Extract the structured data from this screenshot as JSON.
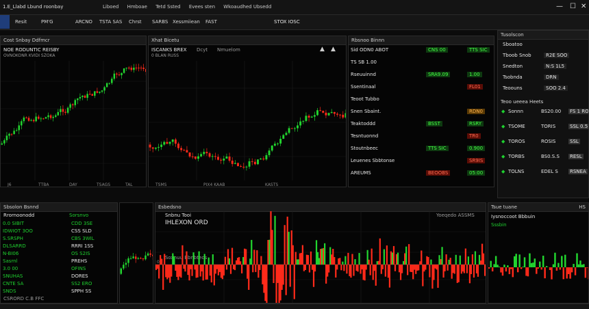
{
  "window": {
    "title": "1.E_Llabd Lbund roonbay",
    "menu": [
      "Liboed",
      "Hmboae",
      "Tetd Ssted",
      "Evees sten",
      "Wkoaudhed Ubsedd"
    ]
  },
  "toolbar": {
    "items": [
      "Resit",
      "PM'G",
      "ARCNO",
      "TSTA SAS",
      "Chrst",
      "SARBS",
      "Xessmiiean",
      "FAST"
    ],
    "center_label": "STOX IOSC"
  },
  "right_header": {
    "label": "Tusolscon"
  },
  "chart1": {
    "header": "Cost Snbay Ddfmcr",
    "title": "NOE RODUNTIC REISBY",
    "subtitle": "OVNOKONR KVIDI SZOKA",
    "x_labels": [
      "J6",
      "TTBA",
      "DAY",
      "TSAGS",
      "TAL"
    ]
  },
  "chart2": {
    "header": "Xhat Bicetu",
    "title": "ISCANKS BREX",
    "subtitle": "0 BLAN RUSS",
    "labels": [
      "Dcyt",
      "Nmuelom"
    ],
    "x_labels": [
      "TSMS",
      "PIX4 KAAB",
      "KASTS"
    ]
  },
  "watch": {
    "header": "Rbsnoo Binnn",
    "rows": [
      {
        "name": "Sid ODN0 ABOT",
        "v1": "CNS 00",
        "v2": "TTS SIC"
      },
      {
        "name": "TS SB 1.00",
        "v1": "",
        "v2": ""
      },
      {
        "name": "Rseuuinnd",
        "v1": "SRA9.09",
        "v2": "1.00"
      },
      {
        "name": "Ssentinaal",
        "v1": "",
        "v2": "FL01"
      },
      {
        "name": "Teoot Tubbo",
        "v1": "",
        "v2": ""
      },
      {
        "name": "Snen Sbaint.",
        "v1": "",
        "v2": "RDN0"
      },
      {
        "name": "Teaktoddd",
        "v1": "BSST",
        "v2": "RSRY"
      },
      {
        "name": "Tesntuonnd",
        "v1": "",
        "v2": "TR0"
      },
      {
        "name": "Stoutnbeec",
        "v1": "TTS SIC",
        "v2": "0.900"
      },
      {
        "name": "Leuenes Sbbtonse",
        "v1": "",
        "v2": "SR9IS"
      },
      {
        "name": "AREUMS",
        "v1": "BEOOBS",
        "v2": "05:00"
      }
    ]
  },
  "orders": {
    "header": "Tusolscon",
    "top": [
      {
        "label": "Sboatoo",
        "value": ""
      },
      {
        "label": "Tboob Snob",
        "value": "R2E SOO"
      },
      {
        "label": "Snedton",
        "value": "N:S 1L5"
      },
      {
        "label": "Tsobnda",
        "value": "DRN"
      },
      {
        "label": "Teoouns",
        "value": "SOO 2.4"
      }
    ],
    "subheader": "Teoo ueeea Heets",
    "rows": [
      {
        "label": "Sonnn",
        "value": "BS20.00",
        "delta": "FS 1 ROS"
      },
      {
        "label": "TSOME",
        "value": "TORIS",
        "delta": "SSL 0.5"
      },
      {
        "label": "TOROS",
        "value": "ROSIS",
        "delta": "SSL"
      },
      {
        "label": "TORBS",
        "value": "BS0.S.S",
        "delta": "RESL"
      },
      {
        "label": "TOLNS",
        "value": "EDEL S",
        "delta": "RSNEA"
      }
    ]
  },
  "bottom_left": {
    "header": "Sbsolon Bsnnd",
    "sub": "Rrornoonodd",
    "label2": "Sorsnvo",
    "rows": [
      {
        "name": "0.0 SIBIT",
        "v": "CDD 3SE"
      },
      {
        "name": "IDWIOT 3OO",
        "v": "CSS SLD"
      },
      {
        "name": "S.SRSPH",
        "v": "CBS 3WIL"
      },
      {
        "name": "DLSARRD",
        "v": "RRRI 1SS"
      },
      {
        "name": "N-BI06",
        "v": "OS S2IS"
      },
      {
        "name": "Sasrnl",
        "v": "PREHS"
      },
      {
        "name": "3.0 00",
        "v": "OFINS"
      },
      {
        "name": "SNUHAS",
        "v": "DORES"
      },
      {
        "name": "CNTE SA",
        "v": "SS2 ERO"
      },
      {
        "name": "SNDS",
        "v": "SPPH SS"
      }
    ],
    "footer": "CSRORD  C.B FFC"
  },
  "bottom_chart": {
    "header": "Esbedsno",
    "title": "Snbnu Tooi",
    "label1": "IHLEXON ORD",
    "label2": "Soxnuu Bbnbteos",
    "right_label": "Yoeqedo ASSMS",
    "zero_label": "0"
  },
  "bottom_right": {
    "header": "Tsue tuane",
    "tab": "HS",
    "label": "Iysnoccoot Bbbuin",
    "value": "Sssbin"
  }
}
